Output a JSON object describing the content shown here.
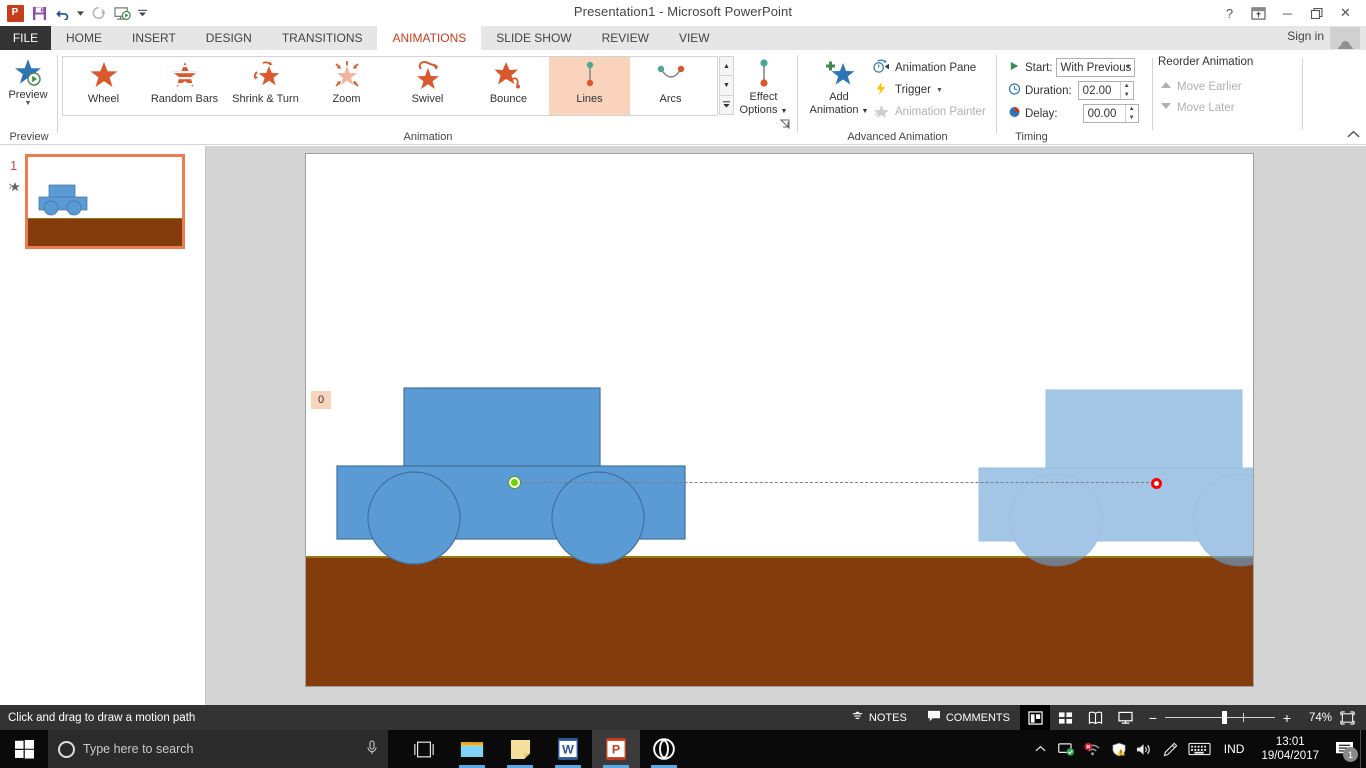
{
  "titlebar": {
    "title": "Presentation1 - Microsoft PowerPoint",
    "qat": [
      {
        "name": "powerpoint-logo",
        "label": "P"
      },
      {
        "name": "save-icon",
        "label": "Save"
      },
      {
        "name": "undo-icon",
        "label": "Undo"
      },
      {
        "name": "redo-icon",
        "label": "Redo"
      },
      {
        "name": "start-slideshow-icon",
        "label": "Start From Beginning"
      },
      {
        "name": "customize-qat-icon",
        "label": "Customize Quick Access Toolbar"
      }
    ],
    "window_controls": {
      "help": "?",
      "ribbon_display": "Ribbon Display Options",
      "minimize": "─",
      "restore": "❐",
      "close": "✕"
    },
    "signin": "Sign in"
  },
  "tabs": {
    "file": "FILE",
    "items": [
      "HOME",
      "INSERT",
      "DESIGN",
      "TRANSITIONS",
      "ANIMATIONS",
      "SLIDE SHOW",
      "REVIEW",
      "VIEW"
    ],
    "active": "ANIMATIONS"
  },
  "ribbon": {
    "groups": {
      "preview": {
        "label": "Preview",
        "button_label": "Preview"
      },
      "animation": {
        "label": "Animation",
        "gallery": [
          {
            "label": "Wheel",
            "icon": "star-wheel-icon",
            "selected": false
          },
          {
            "label": "Random Bars",
            "icon": "star-random-bars-icon",
            "selected": false
          },
          {
            "label": "Shrink & Turn",
            "icon": "star-shrink-turn-icon",
            "selected": false
          },
          {
            "label": "Zoom",
            "icon": "star-zoom-icon",
            "selected": false
          },
          {
            "label": "Swivel",
            "icon": "star-swivel-icon",
            "selected": false
          },
          {
            "label": "Bounce",
            "icon": "star-bounce-icon",
            "selected": false
          },
          {
            "label": "Lines",
            "icon": "motion-path-lines-icon",
            "selected": true
          },
          {
            "label": "Arcs",
            "icon": "motion-path-arcs-icon",
            "selected": false
          }
        ],
        "effect_options": "Effect\nOptions"
      },
      "advanced_animation": {
        "label": "Advanced Animation",
        "add_animation": "Add\nAnimation",
        "items": [
          {
            "label": "Animation Pane",
            "icon": "animation-pane-icon",
            "disabled": false
          },
          {
            "label": "Trigger",
            "icon": "trigger-lightning-icon",
            "disabled": false
          },
          {
            "label": "Animation Painter",
            "icon": "animation-painter-icon",
            "disabled": true
          }
        ]
      },
      "timing": {
        "label": "Timing",
        "start_label": "Start:",
        "start_value": "With Previous",
        "duration_label": "Duration:",
        "duration_value": "02.00",
        "delay_label": "Delay:",
        "delay_value": "00.00",
        "reorder_title": "Reorder Animation",
        "move_earlier": "Move Earlier",
        "move_later": "Move Later"
      }
    }
  },
  "thumbnail_pane": {
    "slide_number": "1",
    "animation_indicator": "animation-star-icon"
  },
  "slide": {
    "animation_tag": "0",
    "colors": {
      "car_body": "#5b9bd5",
      "car_outline": "#41719c",
      "car_ghost": "#a5c8e8",
      "ground": "#843c0c",
      "ground_top_line": "#9a7a10",
      "path_start_marker": "#6cd400",
      "path_end_marker": "#ff0000",
      "path_line": "#7f7f7f"
    },
    "objects": [
      {
        "name": "car-shape-original",
        "state": "original"
      },
      {
        "name": "car-shape-ghost-preview",
        "state": "motion-path-endpoint-preview"
      },
      {
        "name": "ground-rectangle",
        "state": "static"
      },
      {
        "name": "motion-path-line",
        "state": "dashed"
      }
    ]
  },
  "statusbar": {
    "message": "Click and drag to draw a motion path",
    "notes": "NOTES",
    "comments": "COMMENTS",
    "views": [
      {
        "name": "normal-view",
        "active": true
      },
      {
        "name": "slide-sorter-view",
        "active": false
      },
      {
        "name": "reading-view",
        "active": false
      },
      {
        "name": "slide-show-view",
        "active": false
      }
    ],
    "zoom_out": "−",
    "zoom_in": "+",
    "zoom_level": "74%",
    "fit_to_window": "fit-slide-icon"
  },
  "taskbar": {
    "start": "start-icon",
    "search_placeholder": "Type here to search",
    "mic": "microphone-icon",
    "task_view": "task-view-icon",
    "apps": [
      {
        "name": "file-explorer-icon",
        "running": true,
        "active": false
      },
      {
        "name": "sticky-notes-icon",
        "running": true,
        "active": false
      },
      {
        "name": "word-icon",
        "label": "W",
        "running": true,
        "active": false
      },
      {
        "name": "powerpoint-icon",
        "label": "P",
        "running": true,
        "active": true
      },
      {
        "name": "opera-icon",
        "running": true,
        "active": false
      }
    ],
    "tray": {
      "show_hidden": "chevron-up-icon",
      "icons": [
        "screen-snip-icon",
        "network-error-icon",
        "security-warning-icon",
        "volume-icon",
        "pen-icon",
        "touch-keyboard-icon"
      ],
      "language": "IND",
      "time": "13:01",
      "date": "19/04/2017",
      "notifications_count": "1"
    }
  }
}
